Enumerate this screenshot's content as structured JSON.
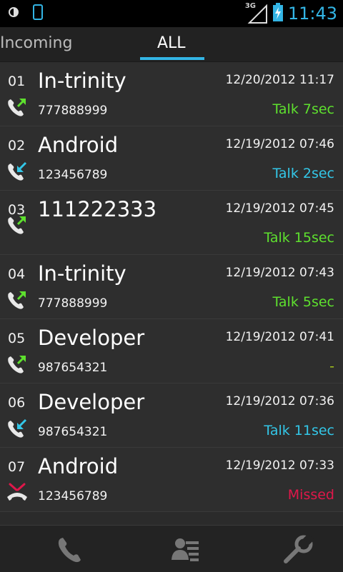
{
  "status_bar": {
    "time": "11:43",
    "network": "3G",
    "icons": [
      "brightness-icon",
      "phone-device-icon",
      "signal-icon",
      "battery-charging-icon"
    ]
  },
  "tabs": [
    {
      "label": "Incoming",
      "selected": false
    },
    {
      "label": "ALL",
      "selected": true
    }
  ],
  "colors": {
    "accent": "#33b5e5",
    "talk_green": "#5ee02e",
    "talk_blue": "#33c7e8",
    "missed": "#e0174a"
  },
  "calls": [
    {
      "index": "01",
      "name": "In-trinity",
      "date": "12/20/2012 11:17",
      "number": "777888999",
      "status": "Talk 7sec",
      "type": "outgoing"
    },
    {
      "index": "02",
      "name": "Android",
      "date": "12/19/2012 07:46",
      "number": "123456789",
      "status": "Talk 2sec",
      "type": "incoming"
    },
    {
      "index": "03",
      "name": "111222333",
      "date": "12/19/2012 07:45",
      "number": "",
      "status": "Talk 15sec",
      "type": "outgoing"
    },
    {
      "index": "04",
      "name": "In-trinity",
      "date": "12/19/2012 07:43",
      "number": "777888999",
      "status": "Talk 5sec",
      "type": "outgoing"
    },
    {
      "index": "05",
      "name": "Developer",
      "date": "12/19/2012 07:41",
      "number": "987654321",
      "status": "-",
      "type": "outgoing"
    },
    {
      "index": "06",
      "name": "Developer",
      "date": "12/19/2012 07:36",
      "number": "987654321",
      "status": "Talk 11sec",
      "type": "incoming"
    },
    {
      "index": "07",
      "name": "Android",
      "date": "12/19/2012 07:33",
      "number": "123456789",
      "status": "Missed",
      "type": "missed"
    }
  ],
  "bottom_bar": {
    "buttons": [
      "phone-icon",
      "contacts-list-icon",
      "settings-wrench-icon"
    ]
  }
}
